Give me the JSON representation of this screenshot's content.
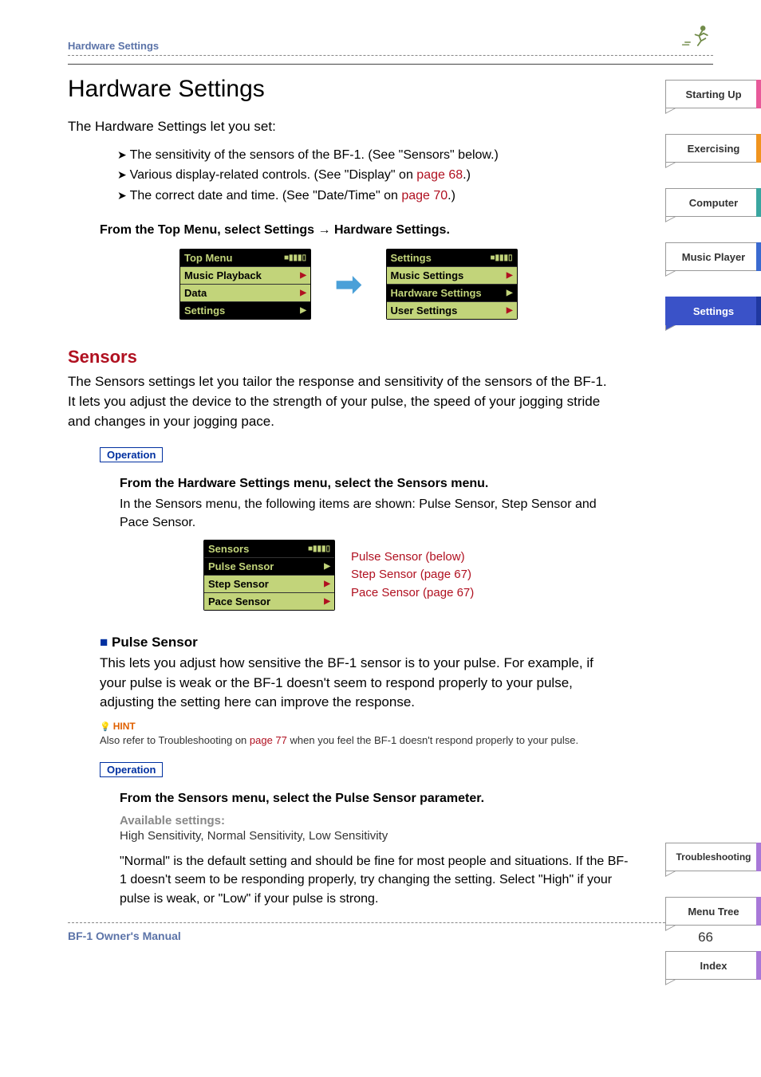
{
  "header": {
    "breadcrumb": "Hardware Settings"
  },
  "title": "Hardware Settings",
  "intro": "The Hardware Settings let you set:",
  "bullets": {
    "b1_pre": "The sensitivity of the sensors of the BF-1. (See \"Sensors\" below.)",
    "b2_pre": "Various display-related controls. (See \"Display\" on ",
    "b2_link": "page 68",
    "b2_post": ".)",
    "b3_pre": "The correct date and time. (See \"Date/Time\" on ",
    "b3_link": "page 70",
    "b3_post": ".)"
  },
  "nav_instruction": "From the Top Menu, select Settings → Hardware Settings.",
  "lcd1": {
    "title": "Top Menu",
    "r1": "Music Playback",
    "r2": "Data",
    "r3": "Settings"
  },
  "lcd2": {
    "title": "Settings",
    "r1": "Music Settings",
    "r2": "Hardware Settings",
    "r3": "User Settings"
  },
  "sensors": {
    "heading": "Sensors",
    "text": "The Sensors settings let you tailor the response and sensitivity of the sensors of the BF-1. It lets you adjust the device to the strength of your pulse, the speed of your jogging stride and changes in your jogging pace.",
    "op_label": "Operation",
    "instr": "From the Hardware Settings menu, select the Sensors menu.",
    "subtext": "In the Sensors menu, the following items are shown: Pulse Sensor, Step Sensor and Pace Sensor."
  },
  "lcd3": {
    "title": "Sensors",
    "r1": "Pulse Sensor",
    "r2": "Step Sensor",
    "r3": "Pace Sensor"
  },
  "sensor_links": {
    "l1": "Pulse Sensor (below)",
    "l2a": "Step Sensor (",
    "l2b": "page 67",
    "l2c": ")",
    "l3a": "Pace Sensor (",
    "l3b": "page 67",
    "l3c": ")"
  },
  "pulse": {
    "heading": "Pulse Sensor",
    "text": "This lets you adjust how sensitive the BF-1 sensor is to your pulse. For example, if your pulse is weak or the BF-1 doesn't seem to respond properly to your pulse, adjusting the setting here can improve the response.",
    "hint_label": "HINT",
    "hint_pre": "Also refer to Troubleshooting on ",
    "hint_link": "page 77",
    "hint_post": " when you feel the BF-1 doesn't respond properly to your pulse.",
    "op_label": "Operation",
    "instr": "From the Sensors menu, select the Pulse Sensor parameter.",
    "avail_head": "Available settings:",
    "avail_text": "High Sensitivity, Normal Sensitivity, Low Sensitivity",
    "final": "\"Normal\" is the default setting and should be fine for most people and situations. If the BF-1 doesn't seem to be responding properly, try changing the setting. Select \"High\" if your pulse is weak, or \"Low\" if your pulse is strong."
  },
  "footer": {
    "left": "BF-1 Owner's Manual",
    "page": "66"
  },
  "tabs": {
    "t1": "Starting Up",
    "t2": "Exercising",
    "t3": "Computer",
    "t4": "Music Player",
    "t5": "Settings",
    "b1": "Troubleshooting",
    "b2": "Menu Tree",
    "b3": "Index"
  }
}
